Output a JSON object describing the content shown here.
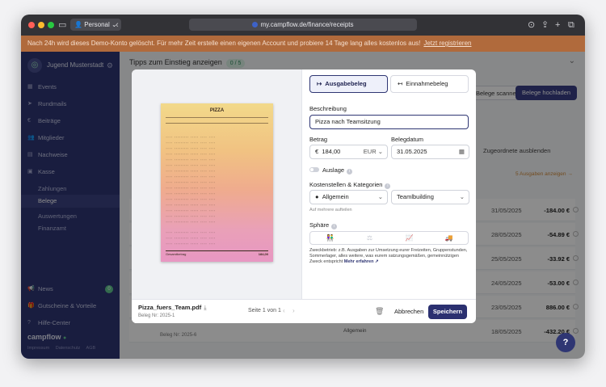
{
  "browser": {
    "profile": "Personal",
    "url": "my.campflow.de/finance/receipts"
  },
  "banner": {
    "text": "Nach 24h wird dieses Demo-Konto gelöscht. Für mehr Zeit erstelle einen eigenen Account und probiere 14 Tage lang alles kostenlos aus!",
    "link": "Jetzt registrieren"
  },
  "sidebar": {
    "org_name": "Jugend Musterstadt",
    "items": [
      {
        "label": "Events",
        "icon": "calendar-icon"
      },
      {
        "label": "Rundmails",
        "icon": "paper-plane-icon"
      },
      {
        "label": "Beiträge",
        "icon": "euro-icon"
      },
      {
        "label": "Mitglieder",
        "icon": "users-icon"
      },
      {
        "label": "Nachweise",
        "icon": "document-icon"
      },
      {
        "label": "Kasse",
        "icon": "cash-register-icon"
      }
    ],
    "sub_items": [
      "Zahlungen",
      "Belege",
      "Auswertungen",
      "Finanzamt"
    ],
    "bottom_items": [
      {
        "label": "News",
        "icon": "megaphone-icon",
        "badge": "0"
      },
      {
        "label": "Gutscheine & Vorteile",
        "icon": "gift-icon"
      },
      {
        "label": "Hilfe-Center",
        "icon": "help-icon"
      }
    ],
    "brand": "campflow",
    "footer_links": [
      "Impressum",
      "Datenschutz",
      "AGB"
    ]
  },
  "main": {
    "tips_label": "Tipps zum Einstieg anzeigen",
    "tips_count": "0 / 5",
    "scan_button": "Belege scannen",
    "upload_button": "Belege hochladen",
    "hide_assigned": "Zugeordnete ausblenden",
    "show_expenses": "5 Ausgaben anzeigen →",
    "rows": [
      {
        "date": "31/05/2025",
        "amount": "-184.00 €"
      },
      {
        "date": "28/05/2025",
        "amount": "-54.89 €"
      },
      {
        "date": "25/05/2025",
        "amount": "-33.92 €"
      },
      {
        "date": "24/05/2025",
        "amount": "-53.00 €"
      },
      {
        "date": "23/05/2025",
        "amount": "886.00 €"
      },
      {
        "date": "18/05/2025",
        "amount": "-432.20 €",
        "title": "Beleg Nr: 2025-6",
        "tag": "Allgemein"
      }
    ]
  },
  "modal": {
    "receipt": {
      "header": "PIZZA",
      "total_label": "Gesamtbetrag",
      "total_value": "184,00"
    },
    "file_name": "Pizza_fuers_Team.pdf",
    "receipt_number": "Beleg Nr: 2025-1",
    "page_info": "Seite 1 von 1",
    "type_expense": "Ausgabebeleg",
    "type_income": "Einnahmebeleg",
    "description_label": "Beschreibung",
    "description_value": "Pizza nach Teamsitzung",
    "amount_label": "Betrag",
    "amount_prefix": "€",
    "amount_value": "184,00",
    "currency": "EUR",
    "date_label": "Belegdatum",
    "date_value": "31.05.2025",
    "expense_toggle_label": "Auslage",
    "cost_label": "Kostenstellen & Kategorien",
    "cost_center": "Allgemein",
    "category": "Teamlbuilding",
    "split_link": "Auf mehrere aufteilen",
    "sphere_label": "Sphäre",
    "sphere_options": [
      "people-icon",
      "scale-icon",
      "chart-icon",
      "truck-icon"
    ],
    "sphere_description": "Zweckbetrieb: z.B. Ausgaben zur Umsetzung eurer Freizeiten, Gruppenstunden, Sommerlager, alles weitere, was eurem satzungsgemäßen, gemeinnützigen Zweck entspricht",
    "learn_more": "Mehr erfahren",
    "cancel_label": "Abbrechen",
    "save_label": "Speichern"
  }
}
